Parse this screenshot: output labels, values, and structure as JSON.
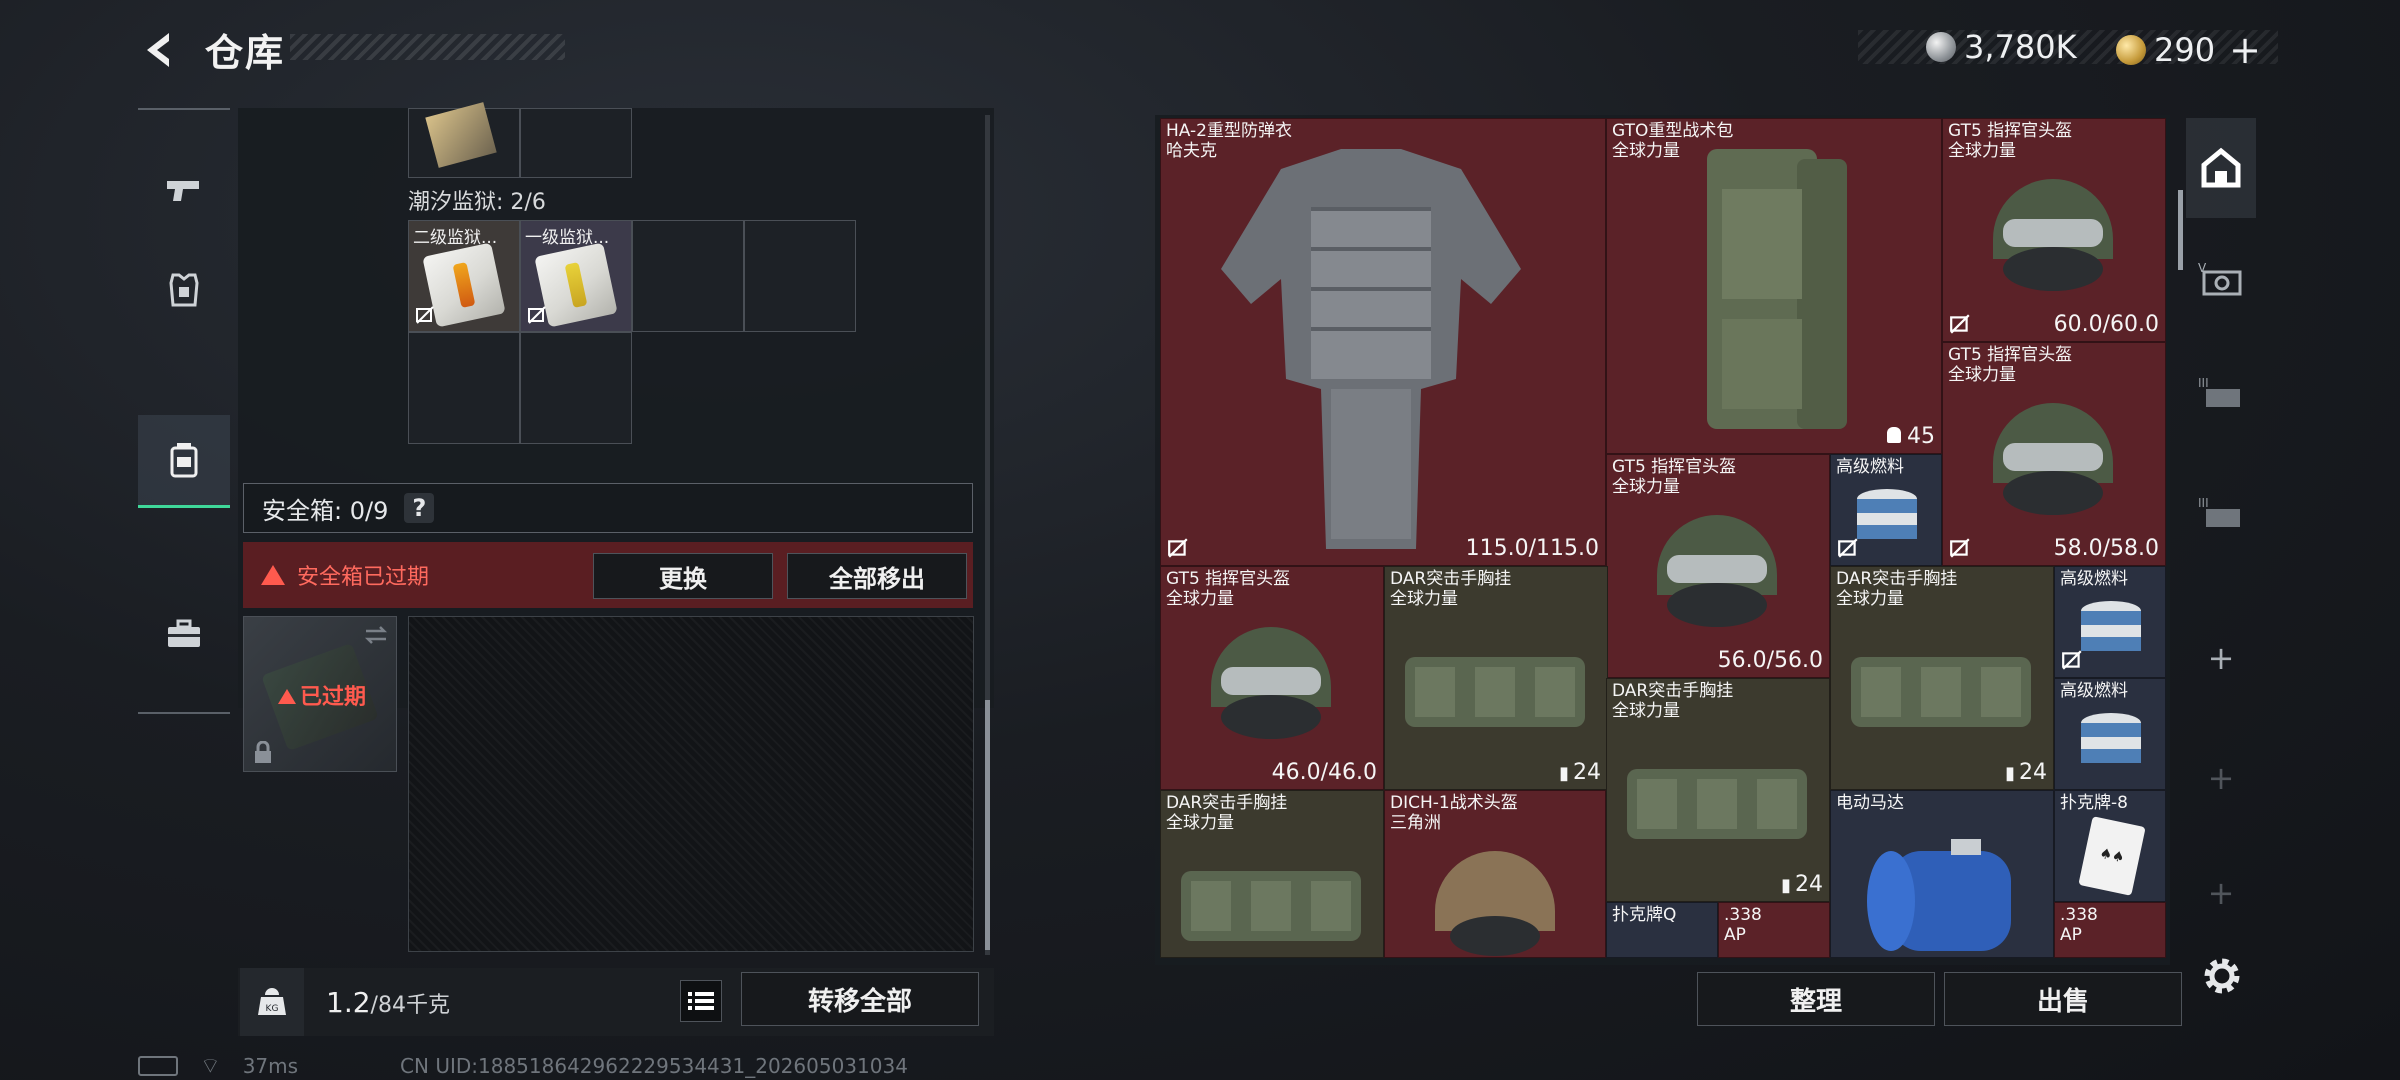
{
  "header": {
    "title": "仓库"
  },
  "currency": {
    "silver": "3,780K",
    "gold": "290",
    "plus": "+"
  },
  "left_panel": {
    "prison_label": "潮汐监狱: 2/6",
    "prison_items": [
      {
        "name": "二级监狱..."
      },
      {
        "name": "一级监狱..."
      }
    ],
    "safe_box": {
      "label": "安全箱: 0/9",
      "help": "?"
    },
    "expired_warning": "安全箱已过期",
    "replace_btn": "更换",
    "remove_all_btn": "全部移出",
    "safe_thumb_label": "已过期",
    "weight": {
      "current": "1.2",
      "max": "/84千克"
    },
    "transfer_all_btn": "转移全部"
  },
  "inventory": {
    "items": [
      {
        "name": "HA-2重型防弹衣",
        "sub": "哈夫克",
        "value": "115.0/115.0"
      },
      {
        "name": "GTO重型战术包",
        "sub": "全球力量",
        "count": "45"
      },
      {
        "name": "GT5 指挥官头盔",
        "sub": "全球力量",
        "value": "60.0/60.0"
      },
      {
        "name": "GT5 指挥官头盔",
        "sub": "全球力量",
        "value": "58.0/58.0"
      },
      {
        "name": "GT5 指挥官头盔",
        "sub": "全球力量",
        "value": "56.0/56.0"
      },
      {
        "name": "高级燃料",
        "sub": ""
      },
      {
        "name": "GT5 指挥官头盔",
        "sub": "全球力量",
        "value": "46.0/46.0"
      },
      {
        "name": "DAR突击手胸挂",
        "sub": "全球力量",
        "count": "24"
      },
      {
        "name": "DAR突击手胸挂",
        "sub": "全球力量",
        "count": "24"
      },
      {
        "name": "高级燃料",
        "sub": ""
      },
      {
        "name": "高级燃料",
        "sub": ""
      },
      {
        "name": "DAR突击手胸挂",
        "sub": "全球力量",
        "count": "24"
      },
      {
        "name": "DAR突击手胸挂",
        "sub": "全球力量"
      },
      {
        "name": "DICH-1战术头盔",
        "sub": "三角洲"
      },
      {
        "name": "电动马达",
        "sub": ""
      },
      {
        "name": "扑克牌-8",
        "sub": ""
      },
      {
        "name": "扑克牌Q",
        "sub": ""
      },
      {
        "name": ".338",
        "sub": "AP"
      },
      {
        "name": ".338",
        "sub": "AP"
      }
    ]
  },
  "actions": {
    "sort": "整理",
    "sell": "出售"
  },
  "status": {
    "ping": "37ms",
    "uid": "CN UID:188518642962229534431_202605031034"
  },
  "colors": {
    "valuable_bg": "#5b2228",
    "accent_green": "#3fd89a",
    "warning_red": "#ff5a4e"
  }
}
